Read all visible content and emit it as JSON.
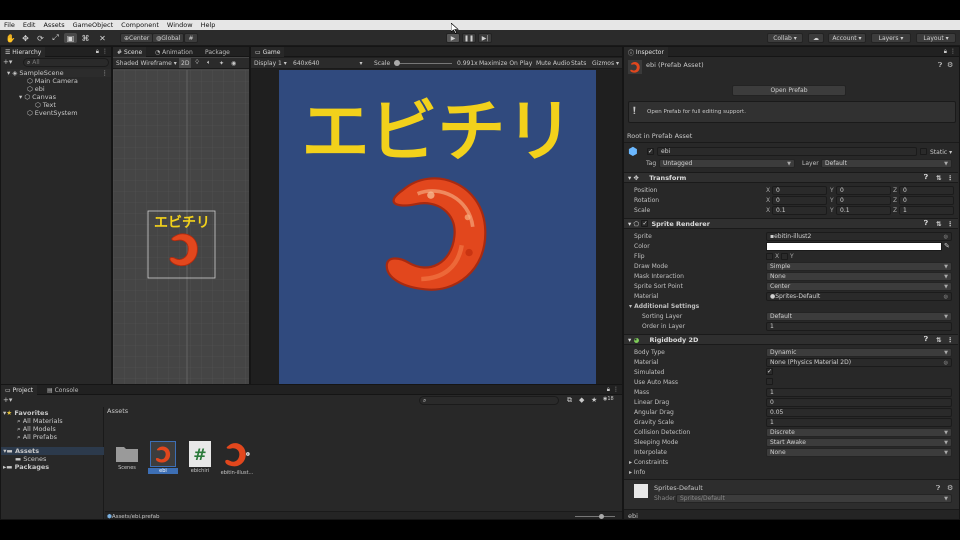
{
  "menu": [
    "File",
    "Edit",
    "Assets",
    "GameObject",
    "Component",
    "Window",
    "Help"
  ],
  "toolbar": {
    "center_label": "Center",
    "global_label": "Global",
    "collab_label": "Collab ▾",
    "account_label": "Account ▾",
    "layers_label": "Layers ▾",
    "layout_label": "Layout ▾"
  },
  "hierarchy": {
    "tab": "Hierarchy",
    "search_placeholder": "All",
    "items": [
      {
        "label": "SampleScene"
      },
      {
        "label": "Main Camera"
      },
      {
        "label": "ebi"
      },
      {
        "label": "Canvas"
      },
      {
        "label": "Text"
      },
      {
        "label": "EventSystem"
      }
    ]
  },
  "scene": {
    "tabs": [
      "Scene",
      "Animation",
      "Package"
    ],
    "draw_mode": "Shaded Wireframe",
    "mode_2d": "2D",
    "sprite_text": "エビチリ"
  },
  "game": {
    "tab": "Game",
    "display": "Display 1",
    "resolution": "640x640",
    "scale_label": "Scale",
    "scale_value": "0.991x",
    "maximize": "Maximize On Play",
    "mute": "Mute Audio",
    "stats": "Stats",
    "gizmos": "Gizmos",
    "title_text": "エビチリ"
  },
  "project": {
    "tabs": [
      "Project",
      "Console"
    ],
    "favorites_label": "Favorites",
    "favorites": [
      "All Materials",
      "All Models",
      "All Prefabs"
    ],
    "assets_label": "Assets",
    "assets_children": [
      "Scenes"
    ],
    "packages_label": "Packages",
    "breadcrumb": "Assets",
    "items": [
      "Scenes",
      "ebi",
      "ebichiri",
      "ebitin-illust..."
    ],
    "footer_path": "Assets/ebi.prefab",
    "count": "18"
  },
  "inspector": {
    "tab": "Inspector",
    "asset_title": "ebi (Prefab Asset)",
    "open_prefab": "Open Prefab",
    "info_text": "Open Prefab for full editing support.",
    "root_label": "Root in Prefab Asset",
    "object_name": "ebi",
    "static_label": "Static",
    "tag_label": "Tag",
    "tag_value": "Untagged",
    "layer_label": "Layer",
    "layer_value": "Default",
    "transform": {
      "title": "Transform",
      "rows": [
        {
          "label": "Position",
          "x": "0",
          "y": "0",
          "z": "0"
        },
        {
          "label": "Rotation",
          "x": "0",
          "y": "0",
          "z": "0"
        },
        {
          "label": "Scale",
          "x": "0.1",
          "y": "0.1",
          "z": "1"
        }
      ]
    },
    "sprite_renderer": {
      "title": "Sprite Renderer",
      "sprite_label": "Sprite",
      "sprite_value": "ebitin-illust2",
      "color_label": "Color",
      "flip_label": "Flip",
      "flip_x": "X",
      "flip_y": "Y",
      "draw_mode_label": "Draw Mode",
      "draw_mode_value": "Simple",
      "mask_label": "Mask Interaction",
      "mask_value": "None",
      "sort_point_label": "Sprite Sort Point",
      "sort_point_value": "Center",
      "material_label": "Material",
      "material_value": "Sprites-Default",
      "additional_label": "Additional Settings",
      "sorting_layer_label": "Sorting Layer",
      "sorting_layer_value": "Default",
      "order_label": "Order in Layer",
      "order_value": "1"
    },
    "rigidbody": {
      "title": "Rigidbody 2D",
      "body_type_label": "Body Type",
      "body_type_value": "Dynamic",
      "material_label": "Material",
      "material_value": "None (Physics Material 2D)",
      "simulated_label": "Simulated",
      "auto_mass_label": "Use Auto Mass",
      "mass_label": "Mass",
      "mass_value": "1",
      "linear_drag_label": "Linear Drag",
      "linear_drag_value": "0",
      "angular_drag_label": "Angular Drag",
      "angular_drag_value": "0.05",
      "gravity_label": "Gravity Scale",
      "gravity_value": "1",
      "collision_label": "Collision Detection",
      "collision_value": "Discrete",
      "sleeping_label": "Sleeping Mode",
      "sleeping_value": "Start Awake",
      "interpolate_label": "Interpolate",
      "interpolate_value": "None",
      "constraints_label": "Constraints",
      "info_label": "Info"
    },
    "material_preview": {
      "name": "Sprites-Default",
      "shader_label": "Shader",
      "shader_value": "Sprites/Default"
    },
    "footer_name": "ebi"
  },
  "colors": {
    "game_bg": "#304a7e",
    "title_yellow": "#f2d11b",
    "shrimp": "#e2471d",
    "accent_blue": "#3d6fb5"
  }
}
